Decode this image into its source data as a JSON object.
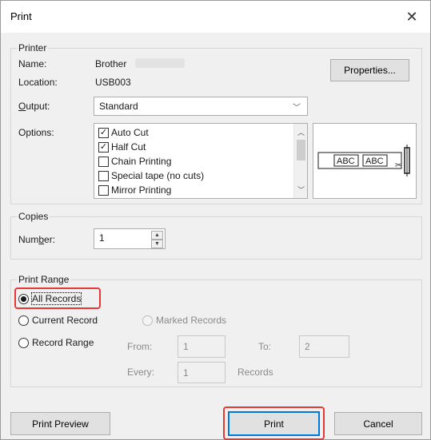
{
  "dialog": {
    "title": "Print",
    "close_glyph": "✕"
  },
  "printer": {
    "group_label": "Printer",
    "name_label": "Name:",
    "name_value": "Brother",
    "location_label": "Location:",
    "location_value": "USB003",
    "properties_button": "Properties...",
    "output_label": "Output:",
    "output_value": "Standard",
    "options_label": "Options:",
    "options": [
      {
        "label": "Auto Cut",
        "checked": true
      },
      {
        "label": "Half Cut",
        "checked": true
      },
      {
        "label": "Chain Printing",
        "checked": false
      },
      {
        "label": "Special tape (no cuts)",
        "checked": false
      },
      {
        "label": "Mirror Printing",
        "checked": false
      }
    ],
    "preview_text_1": "ABC",
    "preview_text_2": "ABC"
  },
  "copies": {
    "group_label": "Copies",
    "number_label": "Number:",
    "number_value": "1"
  },
  "range": {
    "group_label": "Print Range",
    "all_records": "All Records",
    "current_record": "Current Record",
    "marked_records": "Marked Records",
    "record_range": "Record Range",
    "from_label": "From:",
    "from_value": "1",
    "to_label": "To:",
    "to_value": "2",
    "every_label": "Every:",
    "every_value": "1",
    "records_label": "Records",
    "selected": "all_records"
  },
  "buttons": {
    "print_preview": "Print Preview",
    "print": "Print",
    "cancel": "Cancel"
  },
  "colors": {
    "highlight": "#e53935",
    "default_button_border": "#0078d7"
  }
}
